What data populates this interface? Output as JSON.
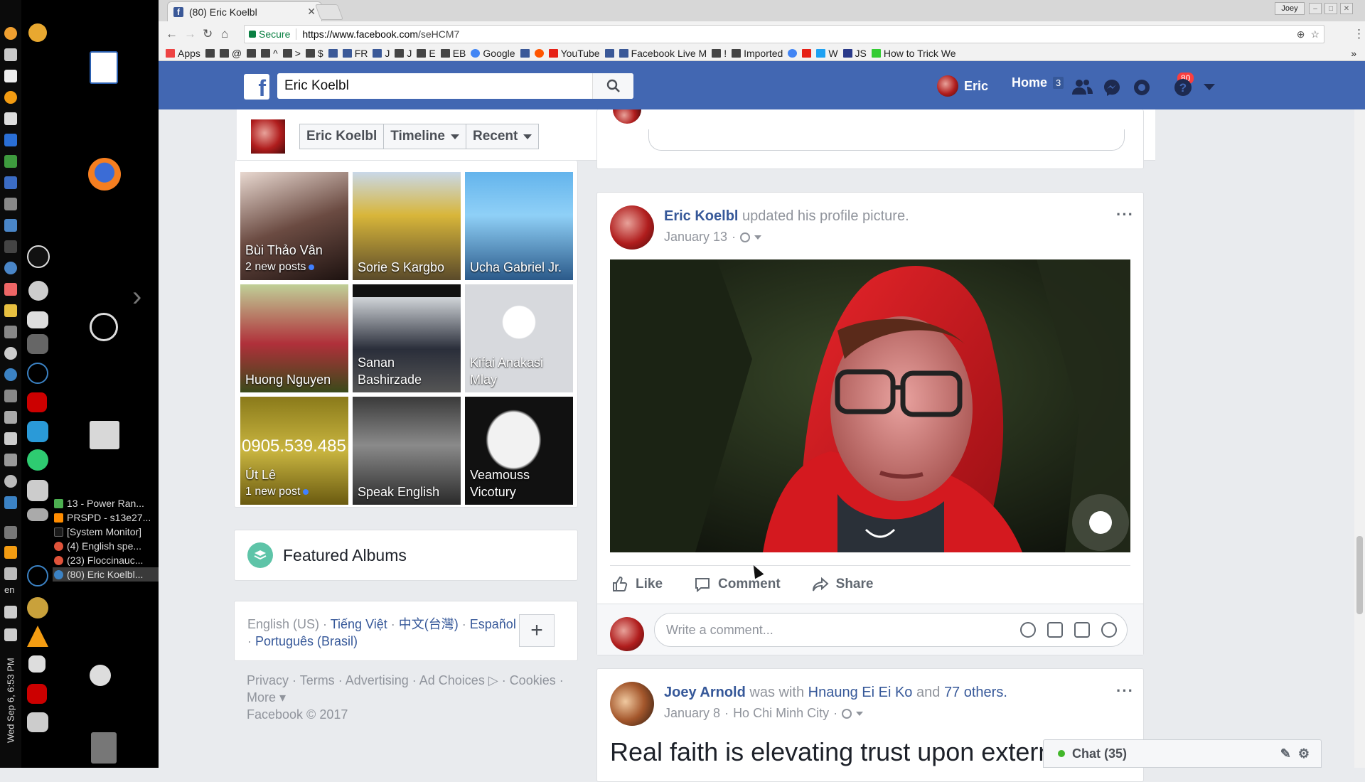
{
  "desktop": {
    "window_list": [
      {
        "label": "13 - Power Ran...",
        "color": "#4caf50"
      },
      {
        "label": "PRSPD - s13e27...",
        "color": "#ff8c00"
      },
      {
        "label": "[System Monitor]",
        "color": "#1a1a1a"
      },
      {
        "label": "(4) English spe...",
        "color": "#e0533a"
      },
      {
        "label": "(23) Floccinauc...",
        "color": "#e0533a"
      },
      {
        "label": "(80) Eric Koelbl...",
        "color": "#3b82c4"
      }
    ],
    "keyboard": "en",
    "clock": "Wed Sep 6, 6:53 PM"
  },
  "browser": {
    "tab_title": "(80) Eric Koelbl",
    "user_button": "Joey",
    "secure_label": "Secure",
    "url_scheme": "https://www.facebook.com",
    "url_path": "/seHCM7",
    "bookmarks": [
      {
        "label": "Apps",
        "icon": "apps-grid-icon"
      },
      {
        "label": "",
        "icon": "folder-icon"
      },
      {
        "label": "@",
        "icon": "folder-icon"
      },
      {
        "label": "",
        "icon": "folder-icon"
      },
      {
        "label": "^",
        "icon": "folder-icon"
      },
      {
        "label": ">",
        "icon": "folder-icon"
      },
      {
        "label": "$",
        "icon": "folder-icon"
      },
      {
        "label": "",
        "icon": "facebook-icon"
      },
      {
        "label": "FR",
        "icon": "facebook-icon"
      },
      {
        "label": "J",
        "icon": "facebook-icon"
      },
      {
        "label": "J",
        "icon": "folder-icon"
      },
      {
        "label": "E",
        "icon": "folder-icon"
      },
      {
        "label": "EB",
        "icon": "folder-icon"
      },
      {
        "label": "Google",
        "icon": "google-icon"
      },
      {
        "label": "",
        "icon": "facebook-icon"
      },
      {
        "label": "",
        "icon": "circle-icon"
      },
      {
        "label": "YouTube",
        "icon": "youtube-icon"
      },
      {
        "label": "",
        "icon": "facebook-icon"
      },
      {
        "label": "Facebook Live M",
        "icon": "facebook-icon"
      },
      {
        "label": "!",
        "icon": "folder-icon"
      },
      {
        "label": "Imported",
        "icon": "folder-icon"
      },
      {
        "label": "",
        "icon": "google-icon"
      },
      {
        "label": "",
        "icon": "youtube-icon"
      },
      {
        "label": "W",
        "icon": "twitter-icon"
      },
      {
        "label": "JS",
        "icon": "j-icon"
      },
      {
        "label": "How to Trick We",
        "icon": "leaf-icon"
      }
    ]
  },
  "facebook": {
    "search_value": "Eric Koelbl",
    "user_name": "Eric",
    "home_label": "Home",
    "home_count": "3",
    "notifications_count": "80",
    "colors": {
      "brand": "#4267b2",
      "link": "#365899",
      "badge": "#fa3e3e"
    },
    "sticky": {
      "name": "Eric Koelbl",
      "timeline": "Timeline",
      "recent": "Recent"
    },
    "friends": [
      {
        "name": "Bùi Thảo Vân",
        "sub": "2 new posts",
        "dot": true
      },
      {
        "name": "Sorie S Kargbo",
        "sub": "",
        "dot": false
      },
      {
        "name": "Ucha Gabriel Jr.",
        "sub": "",
        "dot": false
      },
      {
        "name": "Huong Nguyen",
        "sub": "",
        "dot": false
      },
      {
        "name": "Sanan Bashirzade",
        "sub": "",
        "dot": false
      },
      {
        "name": "Kifai Anakasi Mlay",
        "sub": "",
        "dot": false
      },
      {
        "name": "Út Lê",
        "sub": "1 new post",
        "dot": true,
        "overlay": "0905.539.485"
      },
      {
        "name": "Speak English",
        "sub": "",
        "dot": false
      },
      {
        "name": "Veamouss Vicotury",
        "sub": "",
        "dot": false
      }
    ],
    "featured_albums": "Featured Albums",
    "languages": {
      "current": "English (US)",
      "others": [
        "Tiếng Việt",
        "中文(台灣)",
        "Español",
        "Português (Brasil)"
      ]
    },
    "footer_links": [
      "Privacy",
      "Terms",
      "Advertising",
      "Ad Choices",
      "Cookies"
    ],
    "footer_more": "More",
    "copyright": "Facebook © 2017",
    "post1": {
      "author": "Eric Koelbl",
      "action": "updated his profile picture.",
      "date": "January 13",
      "like": "Like",
      "comment": "Comment",
      "share": "Share",
      "comment_placeholder": "Write a comment..."
    },
    "post2": {
      "author": "Joey Arnold",
      "with_text": "was with",
      "tagged": "Hnaung Ei Ei Ko",
      "and_text": "and",
      "others": "77 others.",
      "date": "January 8",
      "location": "Ho Chi Minh City",
      "text": "Real faith is elevating trust upon extern"
    },
    "chat_label": "Chat (35)"
  }
}
